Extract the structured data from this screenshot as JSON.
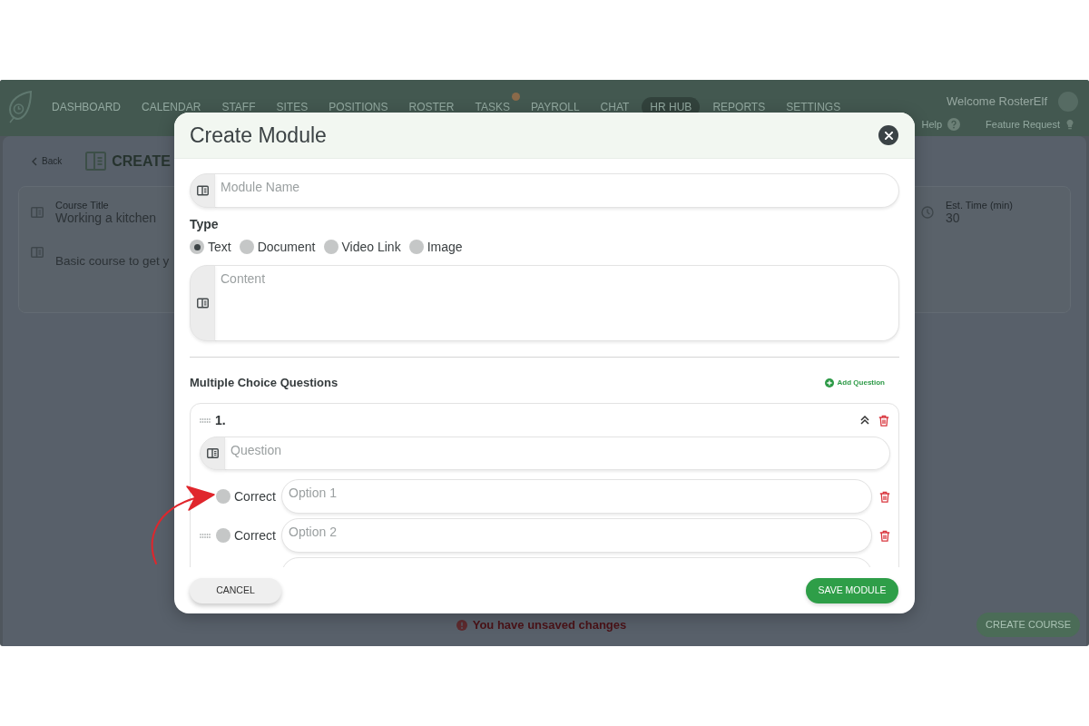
{
  "navbar": {
    "items": [
      {
        "label": "DASHBOARD",
        "selected": false,
        "alert": false
      },
      {
        "label": "CALENDAR",
        "selected": false,
        "alert": false
      },
      {
        "label": "STAFF",
        "selected": false,
        "alert": false
      },
      {
        "label": "SITES",
        "selected": false,
        "alert": false
      },
      {
        "label": "POSITIONS",
        "selected": false,
        "alert": false
      },
      {
        "label": "ROSTER",
        "selected": false,
        "alert": false
      },
      {
        "label": "TASKS",
        "selected": false,
        "alert": true
      },
      {
        "label": "PAYROLL",
        "selected": false,
        "alert": false
      },
      {
        "label": "CHAT",
        "selected": false,
        "alert": false
      },
      {
        "label": "HR HUB",
        "selected": true,
        "alert": false
      },
      {
        "label": "REPORTS",
        "selected": false,
        "alert": false
      },
      {
        "label": "SETTINGS",
        "selected": false,
        "alert": false
      }
    ],
    "welcome": "Welcome RosterElf",
    "links": [
      {
        "kind": "help",
        "label": "Help"
      },
      {
        "kind": "feature",
        "label": "Feature Request"
      }
    ]
  },
  "page": {
    "back": "Back",
    "title": "CREATE",
    "course_title": {
      "label": "Course Title",
      "value": "Working a kitchen"
    },
    "description": {
      "value": "Basic course to get y"
    },
    "est_time": {
      "label": "Est. Time (min)",
      "value": "30"
    },
    "unsaved_notice": "You have unsaved changes",
    "create_button": "CREATE COURSE"
  },
  "modal": {
    "title": "Create Module",
    "name_field": {
      "placeholder": "Module Name"
    },
    "type_label": "Type",
    "types": [
      {
        "label": "Text",
        "selected": true
      },
      {
        "label": "Document",
        "selected": false
      },
      {
        "label": "Video Link",
        "selected": false
      },
      {
        "label": "Image",
        "selected": false
      }
    ],
    "content_field": {
      "placeholder": "Content"
    },
    "questions_heading": "Multiple Choice Questions",
    "add_question": "Add Question",
    "questions": [
      {
        "number": "1.",
        "expanded": true,
        "question_field": {
          "placeholder": "Question"
        },
        "options": [
          {
            "kind": "option",
            "correct_label": "Correct",
            "placeholder": "Option 1",
            "correct": false,
            "drag_handle": false
          },
          {
            "kind": "option",
            "correct_label": "Correct",
            "placeholder": "Option 2",
            "correct": false,
            "drag_handle": true
          },
          {
            "kind": "cut_off"
          }
        ]
      }
    ],
    "cancel": "CANCEL",
    "save": "SAVE MODULE"
  }
}
